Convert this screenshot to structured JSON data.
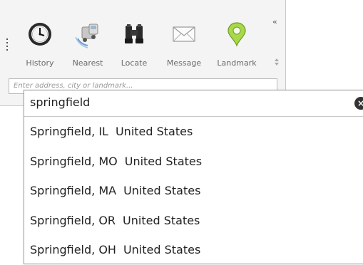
{
  "toolbar": {
    "collapse_glyph": "«",
    "tools": [
      {
        "id": "history",
        "label": "History",
        "icon": "clock-icon"
      },
      {
        "id": "nearest",
        "label": "Nearest",
        "icon": "vehicle-icon"
      },
      {
        "id": "locate",
        "label": "Locate",
        "icon": "binoculars-icon"
      },
      {
        "id": "message",
        "label": "Message",
        "icon": "envelope-icon"
      },
      {
        "id": "landmark",
        "label": "Landmark",
        "icon": "map-pin-icon"
      }
    ],
    "input_placeholder": "Enter address, city or landmark..."
  },
  "search": {
    "value": "springfield",
    "clear_glyph": "×"
  },
  "results": [
    {
      "place": "Springfield, IL",
      "country": "United States"
    },
    {
      "place": "Springfield, MO",
      "country": "United States"
    },
    {
      "place": "Springfield, MA",
      "country": "United States"
    },
    {
      "place": "Springfield, OR",
      "country": "United States"
    },
    {
      "place": "Springfield, OH",
      "country": "United States"
    }
  ],
  "colors": {
    "panel_bg": "#f4f4f4",
    "label": "#6a6a6a",
    "pin": "#a8d94a"
  }
}
